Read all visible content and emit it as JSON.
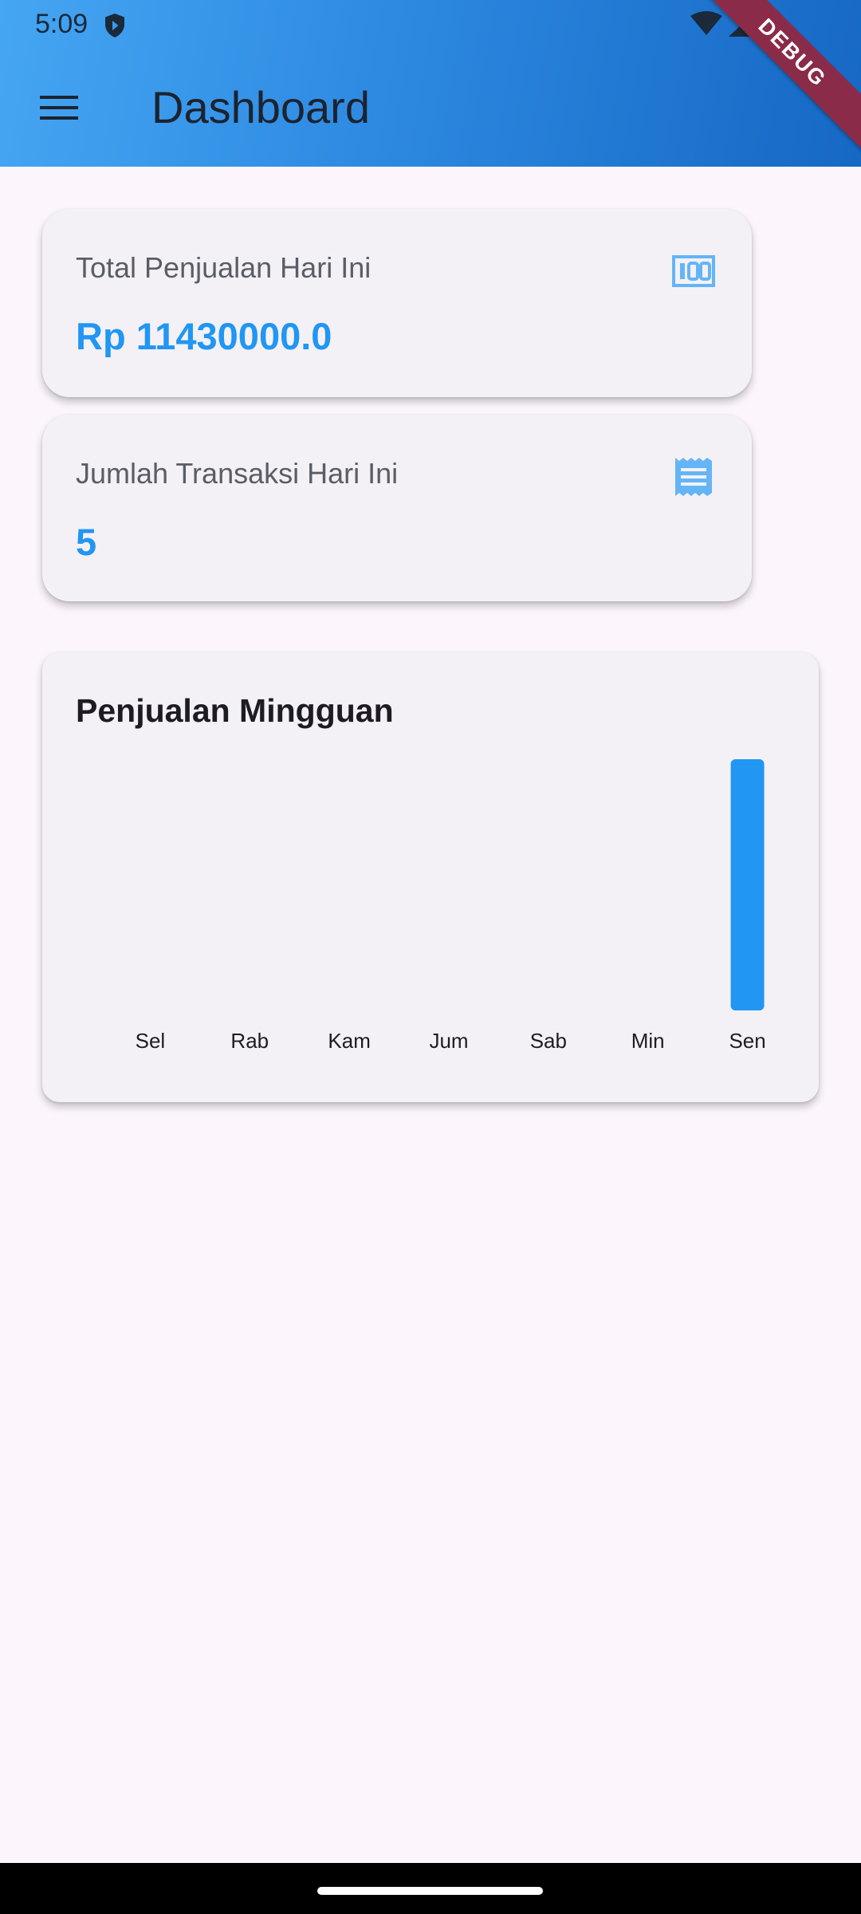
{
  "status_bar": {
    "time": "5:09"
  },
  "app_bar": {
    "title": "Dashboard",
    "debug_label": "DEBUG",
    "gradient_start": "#45a6f3",
    "gradient_end": "#1668c4"
  },
  "cards": {
    "total_sales": {
      "label": "Total Penjualan Hari Ini",
      "value": "Rp 11430000.0",
      "icon": "money-icon"
    },
    "transactions": {
      "label": "Jumlah Transaksi Hari Ini",
      "value": "5",
      "icon": "receipt-icon"
    }
  },
  "accent_color": "#2196f3",
  "chart_data": {
    "type": "bar",
    "title": "Penjualan Mingguan",
    "categories": [
      "Sel",
      "Rab",
      "Kam",
      "Jum",
      "Sab",
      "Min",
      "Sen"
    ],
    "values": [
      0,
      0,
      0,
      0,
      0,
      0,
      11430000
    ],
    "xlabel": "",
    "ylabel": "",
    "grid": false,
    "legend": "none",
    "bar_color": "#2196f3"
  }
}
